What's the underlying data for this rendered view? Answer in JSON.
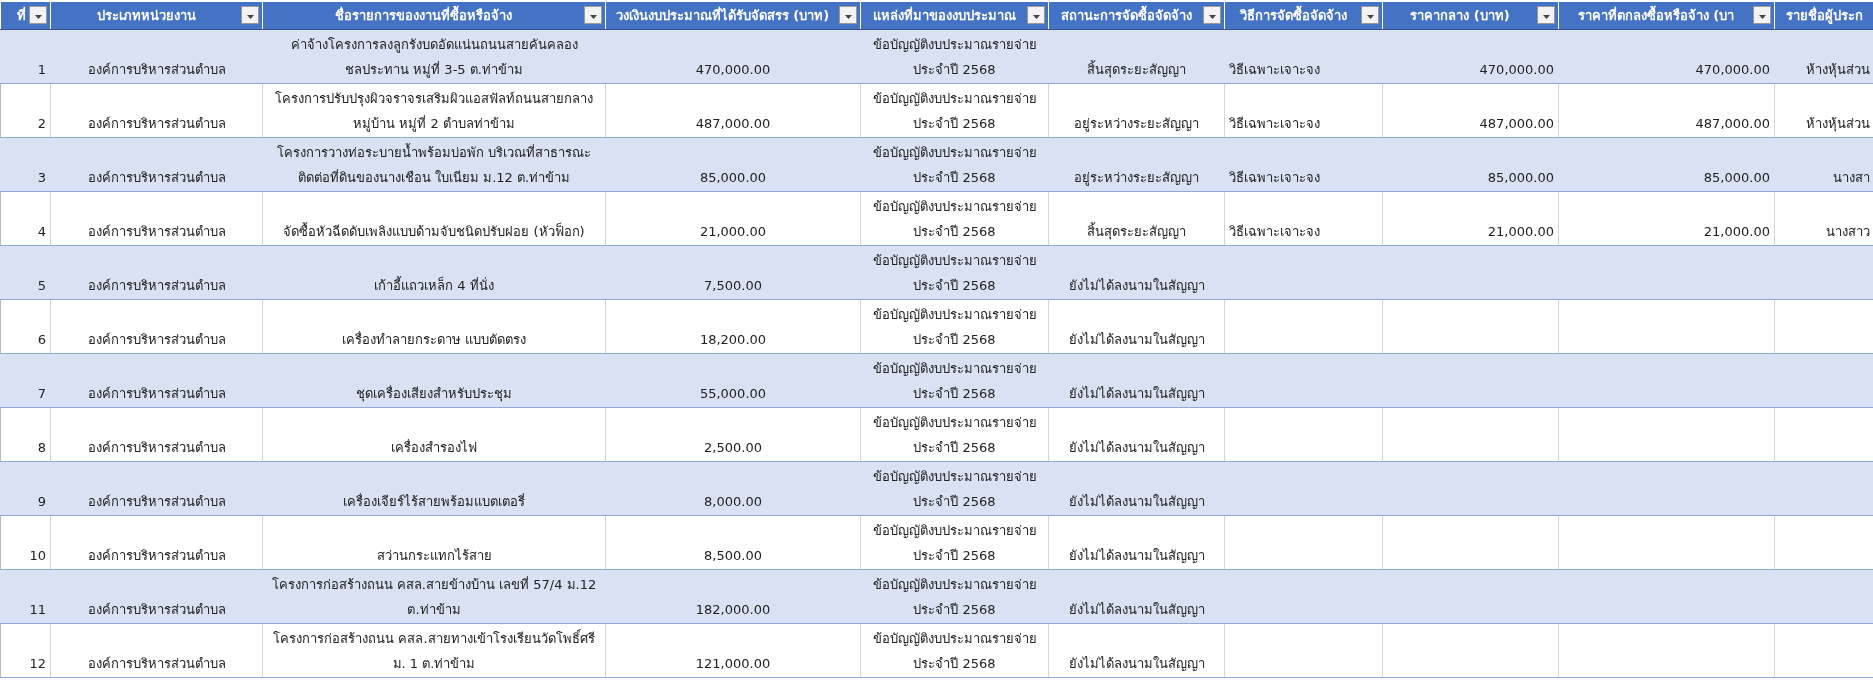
{
  "table": {
    "columns": [
      {
        "label": "ที่",
        "filter": true
      },
      {
        "label": "ประเภทหน่วยงาน",
        "filter": true
      },
      {
        "label": "ชื่อรายการของงานที่ซื้อหรือจ้าง",
        "filter": true
      },
      {
        "label": "วงเงินงบประมาณที่ได้รับจัดสรร (บาท)",
        "filter": true
      },
      {
        "label": "แหล่งที่มาของงบประมาณ",
        "filter": true
      },
      {
        "label": "สถานะการจัดซื้อจัดจ้าง",
        "filter": true
      },
      {
        "label": "วิธีการจัดซื้อจัดจ้าง",
        "filter": true
      },
      {
        "label": "ราคากลาง (บาท)",
        "filter": true
      },
      {
        "label": "ราคาที่ตกลงซื้อหรือจ้าง (บา",
        "filter": true
      },
      {
        "label": "รายชื่อผู้ประก",
        "filter": false
      }
    ],
    "rows": [
      {
        "no": "1",
        "agency_type": "องค์การบริหารส่วนตำบล",
        "item_name": "ค่าจ้างโครงการลงลูกรังบดอัดแน่นถนนสายคันคลอง ชลประทาน หมู่ที่ 3-5 ต.ท่าข้าม",
        "budget": "470,000.00",
        "budget_source": "ข้อบัญญัติงบประมาณรายจ่าย ประจำปี 2568",
        "status": "สิ้นสุดระยะสัญญา",
        "method": "วิธีเฉพาะเจาะจง",
        "median_price": "470,000.00",
        "contract_price": "470,000.00",
        "column_10": "ห้างหุ้นส่วน"
      },
      {
        "no": "2",
        "agency_type": "องค์การบริหารส่วนตำบล",
        "item_name": "โครงการปรับปรุงผิวจราจรเสริมผิวแอสฟัลท์ถนนสายกลาง หมู่บ้าน หมู่ที่ 2 ตำบลท่าข้าม",
        "budget": "487,000.00",
        "budget_source": "ข้อบัญญัติงบประมาณรายจ่าย ประจำปี 2568",
        "status": "อยู่ระหว่างระยะสัญญา",
        "method": "วิธีเฉพาะเจาะจง",
        "median_price": "487,000.00",
        "contract_price": "487,000.00",
        "column_10": "ห้างหุ้นส่วน"
      },
      {
        "no": "3",
        "agency_type": "องค์การบริหารส่วนตำบล",
        "item_name": "โครงการวางท่อระบายน้ำพร้อมบ่อพัก บริเวณที่สาธารณะ ติดต่อที่ดินของนางเชือน ใบเนียม ม.12 ต.ท่าข้าม",
        "budget": "85,000.00",
        "budget_source": "ข้อบัญญัติงบประมาณรายจ่าย ประจำปี 2568",
        "status": "อยู่ระหว่างระยะสัญญา",
        "method": "วิธีเฉพาะเจาะจง",
        "median_price": "85,000.00",
        "contract_price": "85,000.00",
        "column_10": "นางสา"
      },
      {
        "no": "4",
        "agency_type": "องค์การบริหารส่วนตำบล",
        "item_name": "จัดซื้อหัวฉีดดับเพลิงแบบด้ามจับชนิดปรับฝอย (หัวฟ็อก)",
        "budget": "21,000.00",
        "budget_source": "ข้อบัญญัติงบประมาณรายจ่าย ประจำปี 2568",
        "status": "สิ้นสุดระยะสัญญา",
        "method": "วิธีเฉพาะเจาะจง",
        "median_price": "21,000.00",
        "contract_price": "21,000.00",
        "column_10": "นางสาว"
      },
      {
        "no": "5",
        "agency_type": "องค์การบริหารส่วนตำบล",
        "item_name": "เก้าอี้แถวเหล็ก 4 ที่นั่ง",
        "budget": "7,500.00",
        "budget_source": "ข้อบัญญัติงบประมาณรายจ่าย ประจำปี 2568",
        "status": "ยังไม่ได้ลงนามในสัญญา"
      },
      {
        "no": "6",
        "agency_type": "องค์การบริหารส่วนตำบล",
        "item_name": "เครื่องทำลายกระดาษ แบบตัดตรง",
        "budget": "18,200.00",
        "budget_source": "ข้อบัญญัติงบประมาณรายจ่าย ประจำปี 2568",
        "status": "ยังไม่ได้ลงนามในสัญญา"
      },
      {
        "no": "7",
        "agency_type": "องค์การบริหารส่วนตำบล",
        "item_name": "ชุดเครื่องเสียงสำหรับประชุม",
        "budget": "55,000.00",
        "budget_source": "ข้อบัญญัติงบประมาณรายจ่าย ประจำปี 2568",
        "status": "ยังไม่ได้ลงนามในสัญญา"
      },
      {
        "no": "8",
        "agency_type": "องค์การบริหารส่วนตำบล",
        "item_name": "เครื่องสำรองไฟ",
        "budget": "2,500.00",
        "budget_source": "ข้อบัญญัติงบประมาณรายจ่าย ประจำปี 2568",
        "status": "ยังไม่ได้ลงนามในสัญญา"
      },
      {
        "no": "9",
        "agency_type": "องค์การบริหารส่วนตำบล",
        "item_name": "เครื่องเจียร์ไร้สายพร้อมแบตเตอรี่",
        "budget": "8,000.00",
        "budget_source": "ข้อบัญญัติงบประมาณรายจ่าย ประจำปี 2568",
        "status": "ยังไม่ได้ลงนามในสัญญา"
      },
      {
        "no": "10",
        "agency_type": "องค์การบริหารส่วนตำบล",
        "item_name": "สว่านกระแทกไร้สาย",
        "budget": "8,500.00",
        "budget_source": "ข้อบัญญัติงบประมาณรายจ่าย ประจำปี 2568",
        "status": "ยังไม่ได้ลงนามในสัญญา"
      },
      {
        "no": "11",
        "agency_type": "องค์การบริหารส่วนตำบล",
        "item_name": "โครงการก่อสร้างถนน คสล.สายข้างบ้าน เลขที่ 57/4 ม.12 ต.ท่าข้าม",
        "budget": "182,000.00",
        "budget_source": "ข้อบัญญัติงบประมาณรายจ่าย ประจำปี 2568",
        "status": "ยังไม่ได้ลงนามในสัญญา"
      },
      {
        "no": "12",
        "agency_type": "องค์การบริหารส่วนตำบล",
        "item_name": "โครงการก่อสร้างถนน คสล.สายทางเข้าโรงเรียนวัดโพธิ์ศรี ม. 1 ต.ท่าข้าม",
        "budget": "121,000.00",
        "budget_source": "ข้อบัญญัติงบประมาณรายจ่าย ประจำปี 2568",
        "status": "ยังไม่ได้ลงนามในสัญญา"
      }
    ]
  }
}
